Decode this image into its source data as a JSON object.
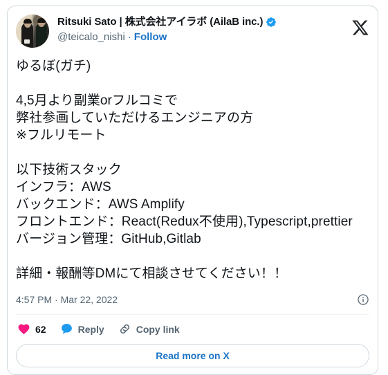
{
  "card": {
    "author": {
      "display_name": "Ritsuki Sato | 株式会社アイラボ (AilaB inc.)",
      "handle": "@teicalo_nishi",
      "separator": "·",
      "follow_label": "Follow",
      "verified": true,
      "avatar_alt": "avatar-photo"
    },
    "brand_icon": "x-logo-icon",
    "tweet_text": "ゆるぼ(ガチ)\n\n4,5月より副業orフルコミで\n弊社参画していただけるエンジニアの方\n※フルリモート\n\n以下技術スタック\nインフラ：AWS\nバックエンド：AWS Amplify\nフロントエンド：React(Redux不使用),Typescript,prettier\nバージョン管理：GitHub,Gitlab\n\n詳細・報酬等DMにて相談させてください！！",
    "timestamp": "4:57 PM · Mar 22, 2022",
    "info_icon": "info-circle-icon",
    "actions": {
      "like": {
        "icon": "heart-icon",
        "count": "62"
      },
      "reply": {
        "icon": "speech-bubble-icon",
        "label": "Reply"
      },
      "copy_link": {
        "icon": "link-icon",
        "label": "Copy link"
      }
    },
    "read_more_label": "Read more on X"
  },
  "colors": {
    "accent_blue": "#1a73c7",
    "verified_blue": "#1d9bf0",
    "like_pink": "#f91880",
    "reply_blue": "#1d9bf0",
    "muted_gray": "#536471",
    "text_primary": "#0f1419",
    "border": "#cfd9de"
  }
}
